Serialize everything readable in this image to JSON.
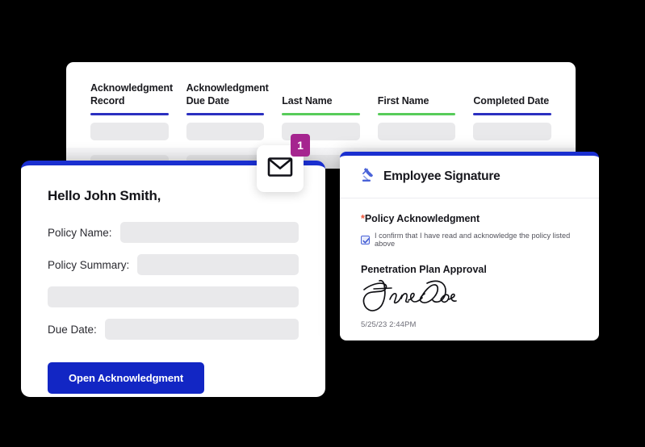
{
  "theme": {
    "background": "#000000",
    "accent_blue": "#1a2fd0",
    "button_blue": "#1226c4",
    "rule_navy": "#2b2fc0",
    "rule_green": "#57cc5a",
    "badge_magenta": "#a5258f",
    "required_red": "#f0563a",
    "placeholder_grey": "#e9e9eb"
  },
  "table_card": {
    "columns": [
      {
        "label": "Acknowledgment\nRecord",
        "rule": "navy"
      },
      {
        "label": "Acknowledgment\nDue Date",
        "rule": "navy"
      },
      {
        "label": "Last Name",
        "rule": "green"
      },
      {
        "label": "First Name",
        "rule": "green"
      },
      {
        "label": "Completed Date",
        "rule": "navy"
      }
    ],
    "rows": [
      {
        "cells": [
          "",
          "",
          "",
          "",
          ""
        ]
      },
      {
        "cells": [
          "",
          "",
          "",
          "",
          ""
        ]
      }
    ]
  },
  "notification": {
    "icon": "envelope-icon",
    "badge_count": "1"
  },
  "email_card": {
    "greeting": "Hello John Smith,",
    "fields": [
      {
        "label": "Policy Name:",
        "value": ""
      },
      {
        "label": "Policy Summary:",
        "value": ""
      },
      {
        "label": "",
        "value": ""
      },
      {
        "label": "Due Date:",
        "value": ""
      }
    ],
    "cta_label": "Open Acknowledgment"
  },
  "signature_card": {
    "header_icon": "gavel-icon",
    "header_title": "Employee Signature",
    "required_marker": "*",
    "section_title": "Policy Acknowledgment",
    "confirm_checkbox_checked": true,
    "confirm_text": "I confirm that I have read and acknowledge the policy listed above",
    "approval_title": "Penetration Plan Approval",
    "signature_name": "Jane Doe",
    "signature_timestamp": "5/25/23 2:44PM"
  }
}
